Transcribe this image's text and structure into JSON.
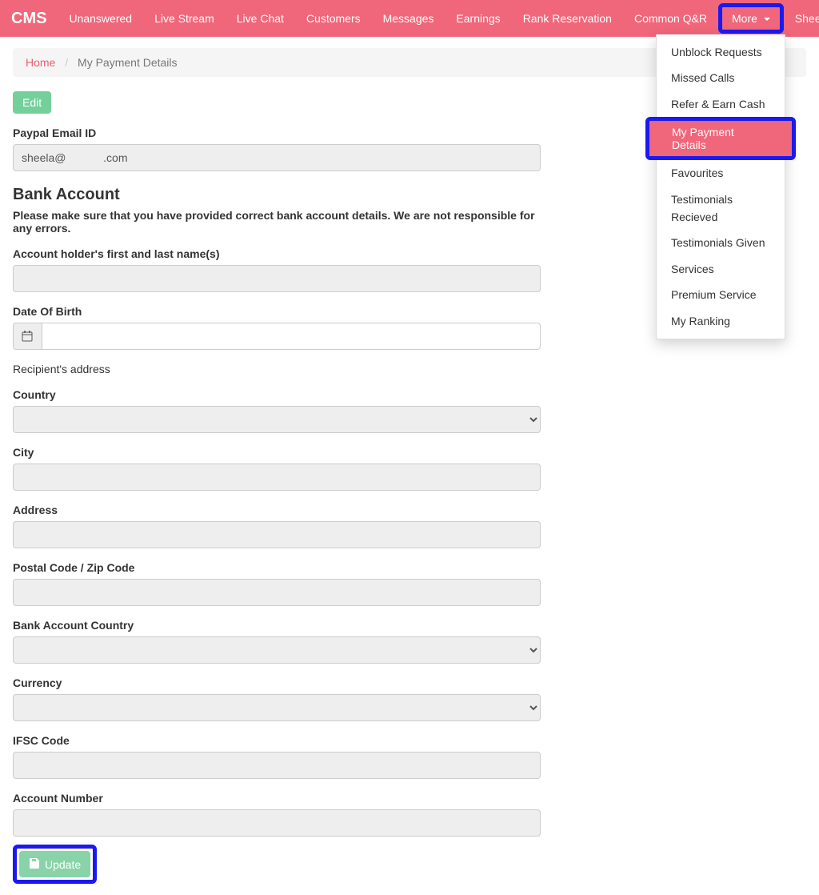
{
  "navbar": {
    "brand": "CMS",
    "items": [
      "Unanswered",
      "Live Stream",
      "Live Chat",
      "Customers",
      "Messages",
      "Earnings",
      "Rank Reservation",
      "Common Q&R"
    ],
    "more_label": "More",
    "user_label": "Sheela"
  },
  "dropdown": {
    "items": [
      {
        "label": "Unblock Requests",
        "active": false
      },
      {
        "label": "Missed Calls",
        "active": false
      },
      {
        "label": "Refer & Earn Cash",
        "active": false
      },
      {
        "label": "My Payment Details",
        "active": true
      },
      {
        "label": "Favourites",
        "active": false
      },
      {
        "label": "Testimonials Recieved",
        "active": false
      },
      {
        "label": "Testimonials Given",
        "active": false
      },
      {
        "label": "Services",
        "active": false
      },
      {
        "label": "Premium Service",
        "active": false
      },
      {
        "label": "My Ranking",
        "active": false
      }
    ]
  },
  "breadcrumb": {
    "home": "Home",
    "current": "My Payment Details"
  },
  "buttons": {
    "edit": "Edit",
    "update": "Update"
  },
  "form": {
    "paypal_label": "Paypal Email ID",
    "paypal_value": "sheela@            .com",
    "bank_title": "Bank Account",
    "bank_note": "Please make sure that you have provided correct bank account details. We are not responsible for any errors.",
    "holder_label": "Account holder's first and last name(s)",
    "holder_value": "",
    "dob_label": "Date Of Birth",
    "dob_value": "",
    "recipient_label": "Recipient's address",
    "country_label": "Country",
    "country_value": "",
    "city_label": "City",
    "city_value": "",
    "address_label": "Address",
    "address_value": "",
    "postal_label": "Postal Code / Zip Code",
    "postal_value": "",
    "bank_country_label": "Bank Account Country",
    "bank_country_value": "",
    "currency_label": "Currency",
    "currency_value": "",
    "ifsc_label": "IFSC Code",
    "ifsc_value": "",
    "account_label": "Account Number",
    "account_value": ""
  },
  "colors": {
    "accent": "#f0667a",
    "highlight_border": "#1a1af0",
    "success": "#73d09b"
  }
}
